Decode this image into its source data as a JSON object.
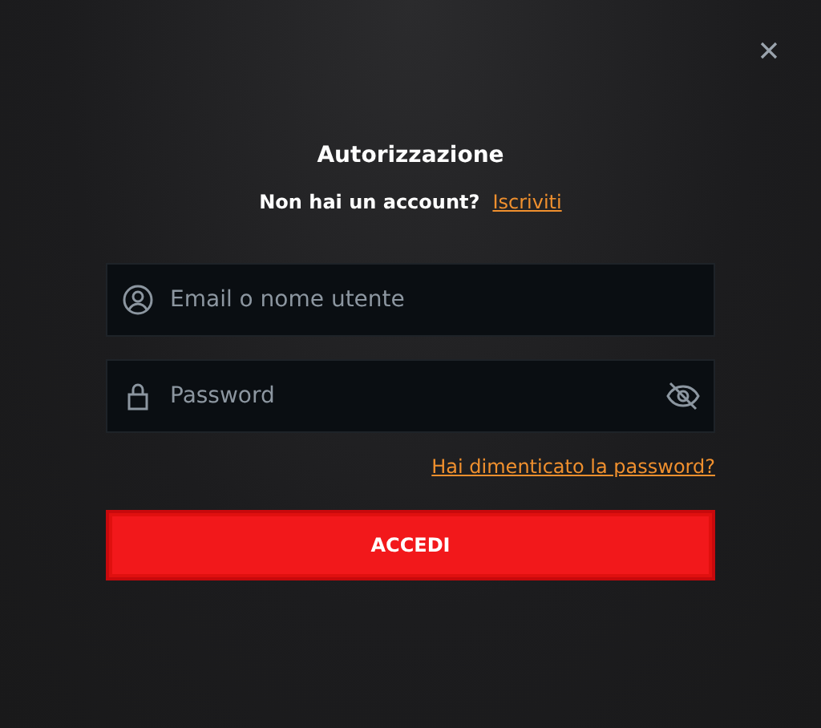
{
  "dialog": {
    "title": "Autorizzazione",
    "prompt": "Non hai un account?",
    "signup_link": "Iscriviti"
  },
  "fields": [
    {
      "kind": "user",
      "placeholder": "Email o nome utente"
    },
    {
      "kind": "password",
      "placeholder": "Password"
    }
  ],
  "forgot_link": "Hai dimenticato la password?",
  "submit": "ACCEDI"
}
